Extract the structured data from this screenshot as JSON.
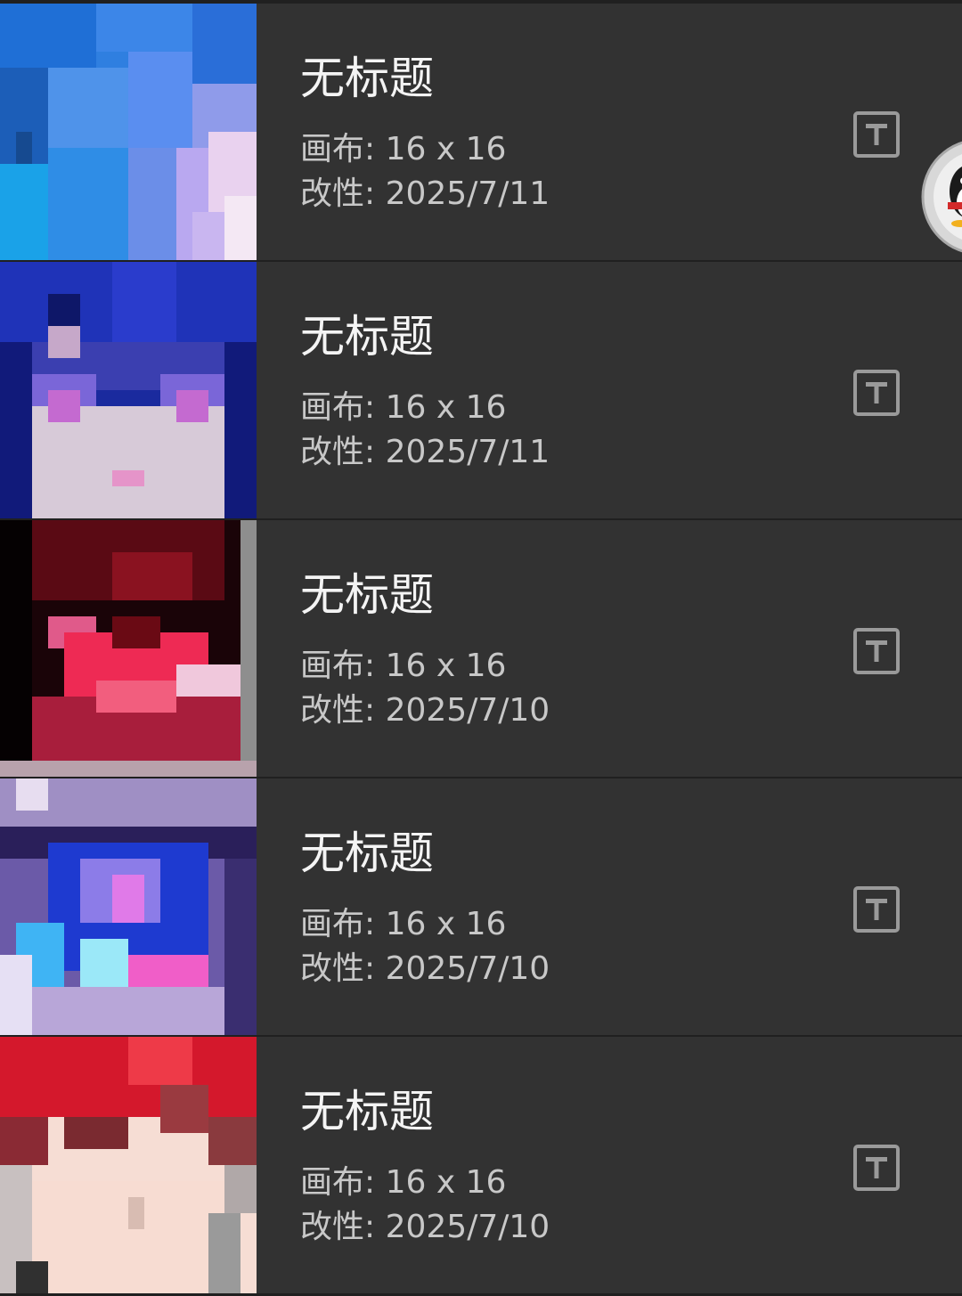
{
  "projects": [
    {
      "title": "无标题",
      "canvas": "画布: 16 x 16",
      "modified": "改性: 2025/7/11"
    },
    {
      "title": "无标题",
      "canvas": "画布: 16 x 16",
      "modified": "改性: 2025/7/11"
    },
    {
      "title": "无标题",
      "canvas": "画布: 16 x 16",
      "modified": "改性: 2025/7/10"
    },
    {
      "title": "无标题",
      "canvas": "画布: 16 x 16",
      "modified": "改性: 2025/7/10"
    },
    {
      "title": "无标题",
      "canvas": "画布: 16 x 16",
      "modified": "改性: 2025/7/10"
    }
  ],
  "icons": {
    "rename": "text-t-icon",
    "floating": "penguin-avatar-icon"
  },
  "colors": {
    "background": "#202020",
    "row": "#323232",
    "title": "#f4f4f4",
    "meta": "#c8c8c8",
    "icon": "#9a9a9a"
  }
}
